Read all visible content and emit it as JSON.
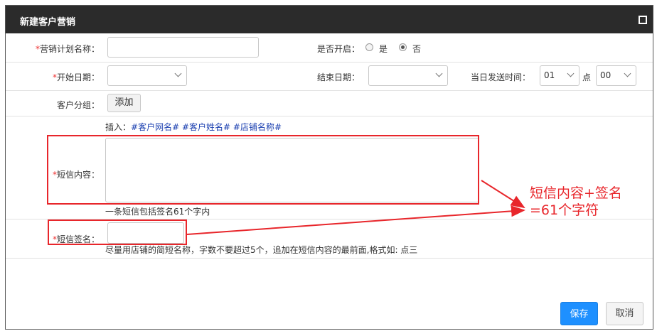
{
  "dialog": {
    "title": "新建客户营销"
  },
  "form": {
    "plan_name": {
      "required_mark": "*",
      "label": "营销计划名称：",
      "value": ""
    },
    "enable": {
      "label": "是否开启：",
      "options": [
        "是",
        "否"
      ],
      "selected": "否"
    },
    "start_date": {
      "required_mark": "*",
      "label": "开始日期：",
      "value": ""
    },
    "end_date": {
      "label": "结束日期：",
      "value": ""
    },
    "send_time": {
      "label": "当日发送时间：",
      "hour": "01",
      "unit": "点",
      "minute": "00"
    },
    "customer_group": {
      "label": "客户分组：",
      "add_button": "添加"
    },
    "insert": {
      "label": "插入：",
      "tags": [
        "#客户网名#",
        "#客户姓名#",
        "#店铺名称#"
      ]
    },
    "sms_content": {
      "required_mark": "*",
      "label": "短信内容：",
      "value": "",
      "hint": "一条短信包括签名61个字内"
    },
    "sms_signature": {
      "required_mark": "*",
      "label": "短信签名：",
      "value": "",
      "hint": "尽量用店铺的简短名称，字数不要超过5个，追加在短信内容的最前面,格式如: 点三"
    }
  },
  "footer": {
    "save": "保存",
    "cancel": "取消"
  },
  "annotation": {
    "line1": "短信内容+签名",
    "line2": "=61个字符",
    "color": "#e8262b"
  },
  "colors": {
    "titlebar": "#2b2b2b",
    "primary": "#1e90ff"
  }
}
